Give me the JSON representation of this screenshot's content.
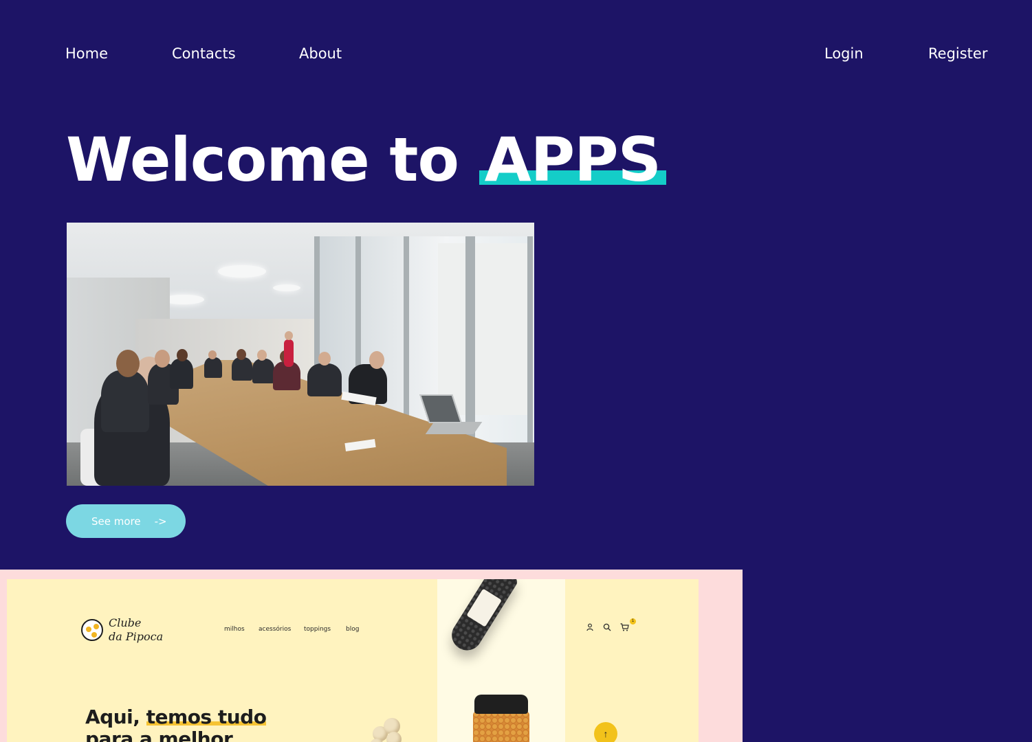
{
  "nav": {
    "left": [
      {
        "label": "Home"
      },
      {
        "label": "Contacts"
      },
      {
        "label": "About"
      }
    ],
    "right": [
      {
        "label": "Login"
      },
      {
        "label": "Register"
      }
    ]
  },
  "hero": {
    "title_prefix": "Welcome to ",
    "title_accent": "APPS",
    "accent_color": "#14cdc8",
    "image_icon": "office-meeting-photo",
    "cta_label": "See more",
    "cta_arrow": "->",
    "cta_color": "#7cd7e3"
  },
  "preview": {
    "background_color": "#fddcdc",
    "site": {
      "logo_line1": "Clube",
      "logo_line2": "da Pipoca",
      "menu": [
        "milhos",
        "acessórios",
        "toppings",
        "blog"
      ],
      "icons": [
        "user-icon",
        "search-icon",
        "cart-icon"
      ],
      "cart_count": "1",
      "headline_prefix": "Aqui, ",
      "headline_highlight": "temos tudo",
      "headline_line2": "para a melhor",
      "scroll_top_glyph": "↑"
    }
  },
  "colors": {
    "background": "#1d1466",
    "text": "#ffffff"
  }
}
